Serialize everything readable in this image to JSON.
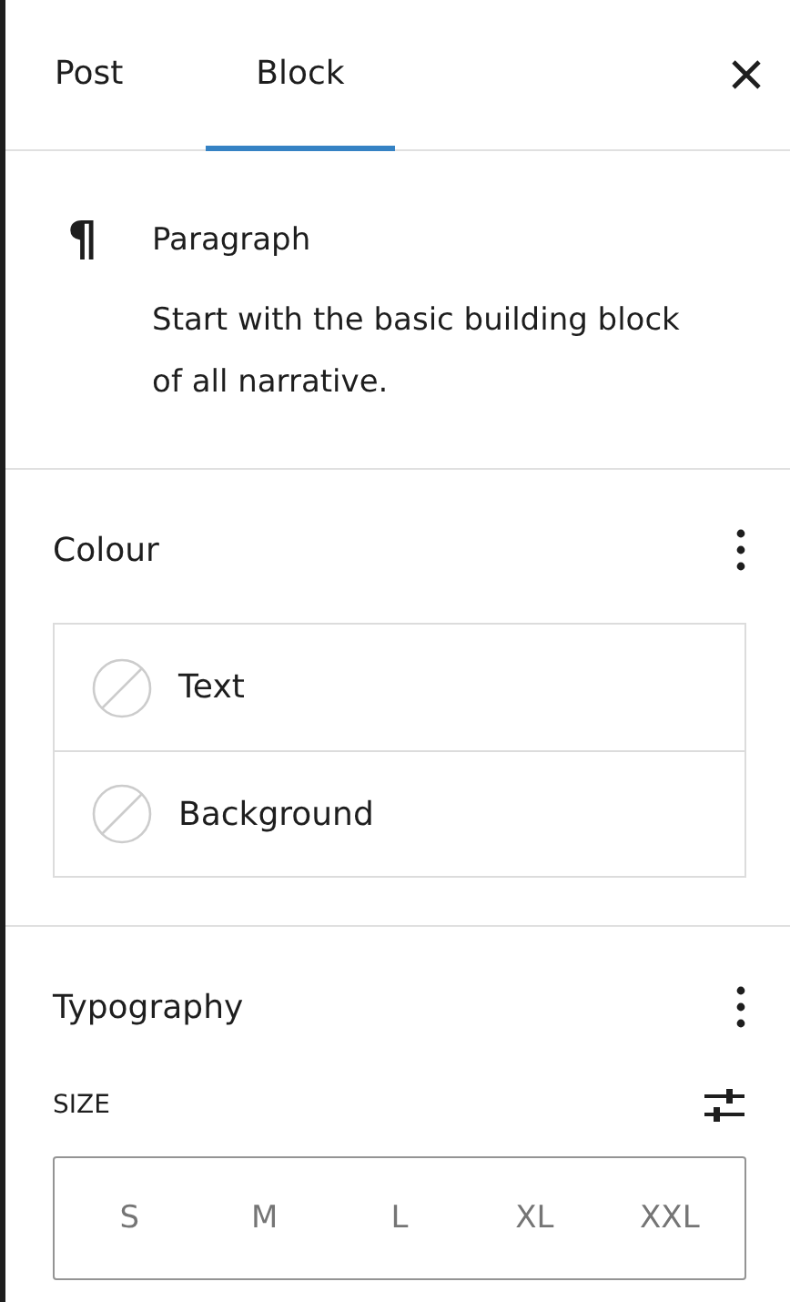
{
  "tabs": [
    {
      "label": "Post",
      "selected": false
    },
    {
      "label": "Block",
      "selected": true
    }
  ],
  "block_card": {
    "icon": "¶",
    "title": "Paragraph",
    "description": "Start with the basic building block of all narrative."
  },
  "colour": {
    "title": "Colour",
    "items": [
      {
        "label": "Text"
      },
      {
        "label": "Background"
      }
    ]
  },
  "typography": {
    "title": "Typography",
    "size_label": "SIZE",
    "sizes": [
      {
        "label": "S",
        "selected": false
      },
      {
        "label": "M",
        "selected": false
      },
      {
        "label": "L",
        "selected": false
      },
      {
        "label": "XL",
        "selected": false
      },
      {
        "label": "XXL",
        "selected": false
      }
    ]
  }
}
